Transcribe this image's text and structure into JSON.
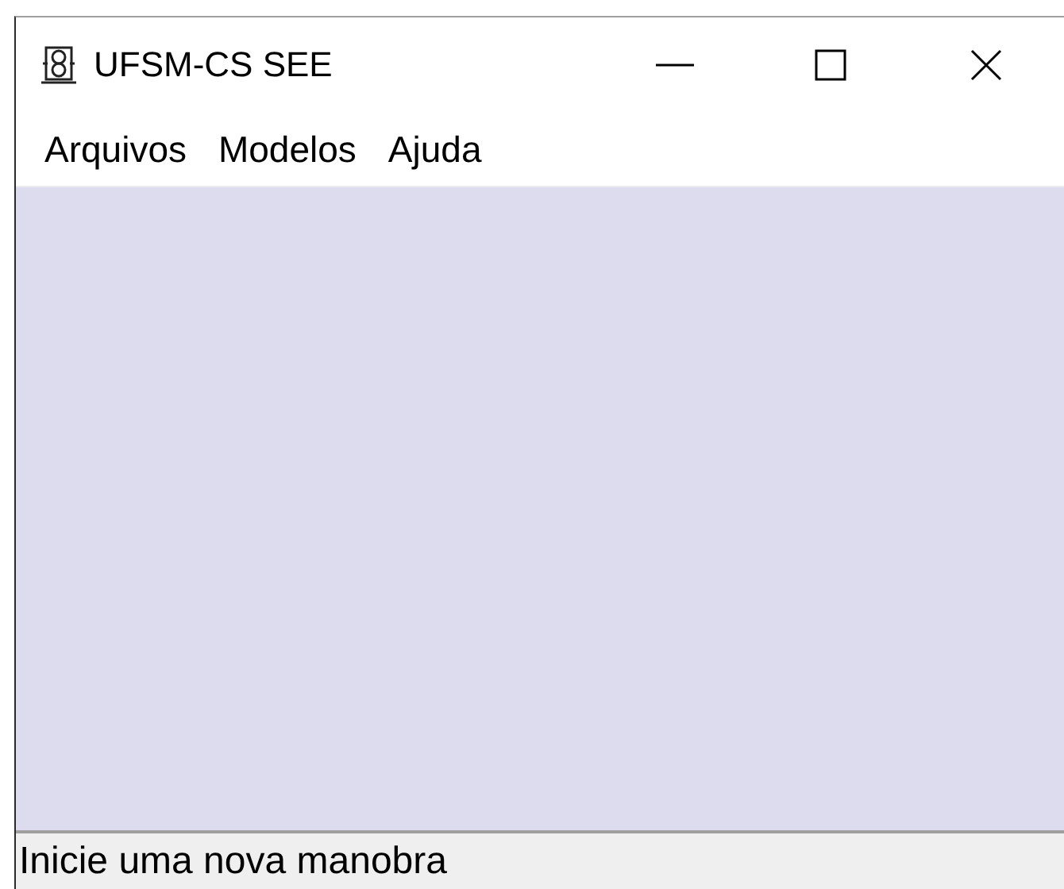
{
  "window": {
    "title": "UFSM-CS SEE"
  },
  "menu": [
    "Arquivos",
    "Modelos",
    "Ajuda"
  ],
  "status_bar": "Inicie uma nova manobra"
}
